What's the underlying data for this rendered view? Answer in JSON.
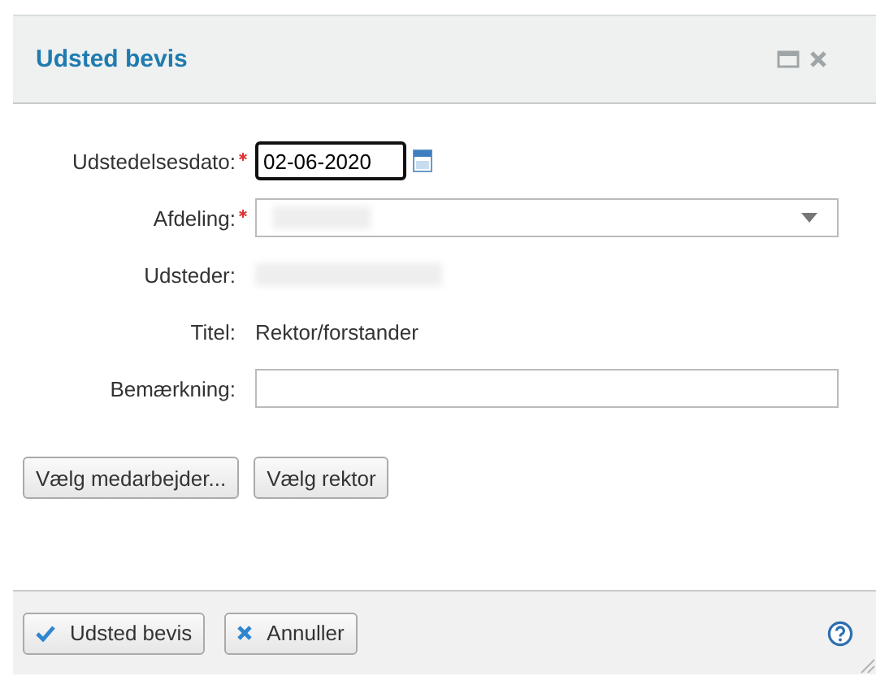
{
  "dialog": {
    "title": "Udsted bevis"
  },
  "fields": [
    {
      "kind": "date",
      "label": "Udstedelsesdato:",
      "required": true,
      "value": "02-06-2020",
      "focused": true
    },
    {
      "kind": "select",
      "label": "Afdeling:",
      "required": true,
      "redacted": true
    },
    {
      "kind": "static",
      "label": "Udsteder:",
      "required": false,
      "redacted": true
    },
    {
      "kind": "static",
      "label": "Titel:",
      "required": false,
      "value": "Rektor/forstander"
    },
    {
      "kind": "input",
      "label": "Bemærkning:",
      "required": false
    }
  ],
  "actions": [
    "Vælg medarbejder...",
    "Vælg rektor"
  ],
  "footer_buttons": [
    {
      "kind": "confirm",
      "label": "Udsted bevis"
    },
    {
      "kind": "cancel",
      "label": "Annuller"
    }
  ]
}
